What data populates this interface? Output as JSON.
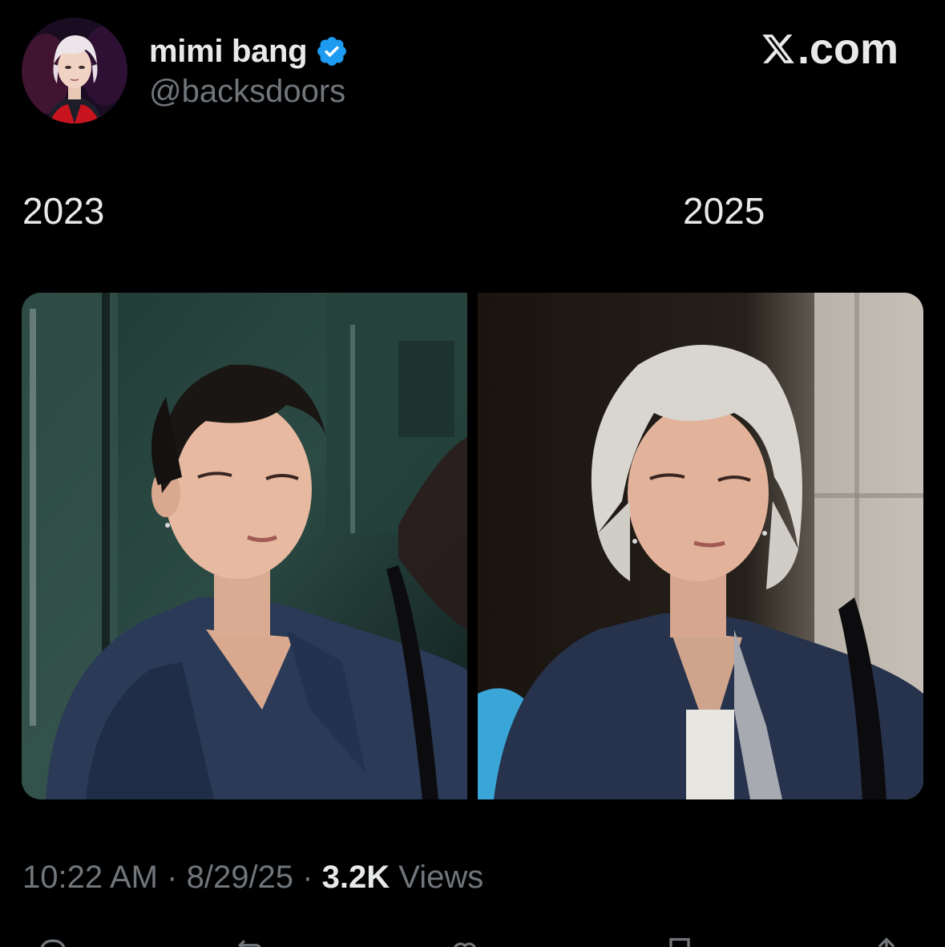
{
  "tweet": {
    "author": {
      "display_name": "mimi bang",
      "handle": "@backsdoors",
      "verified": true,
      "avatar_icon": "avatar-image"
    },
    "watermark": {
      "text": ".com",
      "logo_icon": "x-logo-icon"
    },
    "body": {
      "left_label": "2023",
      "right_label": "2025"
    },
    "media": [
      {
        "icon": "photo-2023",
        "hair_color": "#1a1614",
        "jacket_color": "#2a3a57"
      },
      {
        "icon": "photo-2025",
        "hair_color": "#d8d6cf",
        "jacket_color": "#27324d"
      }
    ],
    "meta": {
      "time": "10:22 AM",
      "separator": "·",
      "date": "8/29/25",
      "views_count": "3.2K",
      "views_label": "Views"
    },
    "actions": [
      {
        "name": "reply-icon"
      },
      {
        "name": "retweet-icon"
      },
      {
        "name": "like-icon"
      },
      {
        "name": "bookmark-icon"
      },
      {
        "name": "share-icon"
      }
    ]
  },
  "colors": {
    "background": "#000000",
    "text_primary": "#e7e9ea",
    "text_secondary": "#71767b",
    "verified_blue": "#1d9bf0"
  }
}
